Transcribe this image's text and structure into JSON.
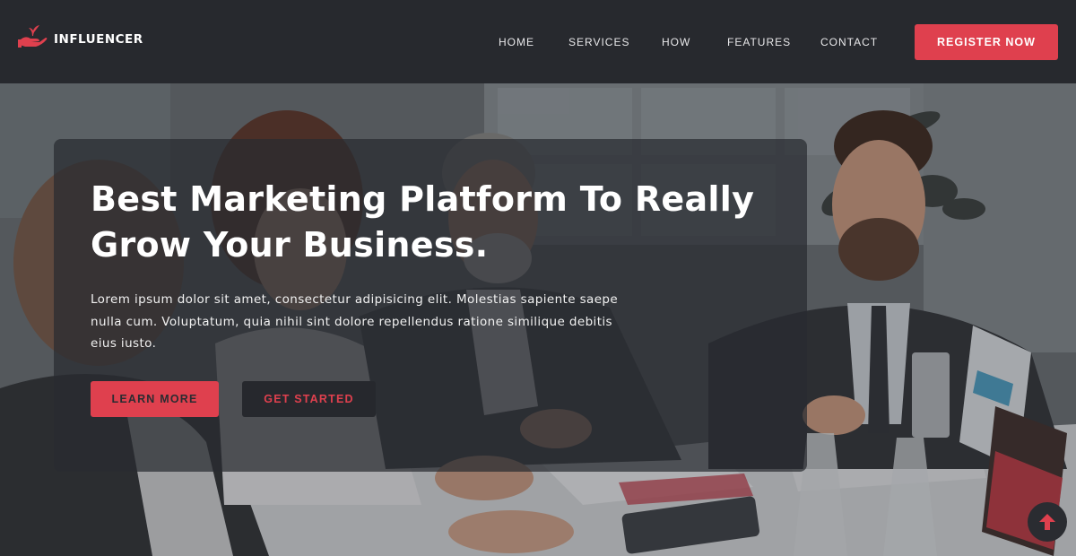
{
  "brand": {
    "logo_text": "INFLUENCER",
    "accent_color": "#df404e",
    "dark_color": "#27292e"
  },
  "nav": {
    "items": [
      {
        "label": "HOME"
      },
      {
        "label": "SERVICES"
      },
      {
        "label": "HOW"
      },
      {
        "label": "FEATURES"
      },
      {
        "label": "CONTACT"
      }
    ],
    "cta_label": "REGISTER NOW"
  },
  "hero": {
    "title_line1": "Best Marketing Platform To Really",
    "title_line2": "Grow Your Business.",
    "description": "Lorem ipsum dolor sit amet, consectetur adipisicing elit. Molestias sapiente saepe nulla cum. Voluptatum, quia nihil sint dolore repellendus ratione similique debitis eius iusto.",
    "learn_more_label": "LEARN MORE",
    "get_started_label": "GET STARTED",
    "background_image": "business-meeting-photo"
  },
  "scroll_top": {
    "icon": "arrow-up-icon"
  }
}
